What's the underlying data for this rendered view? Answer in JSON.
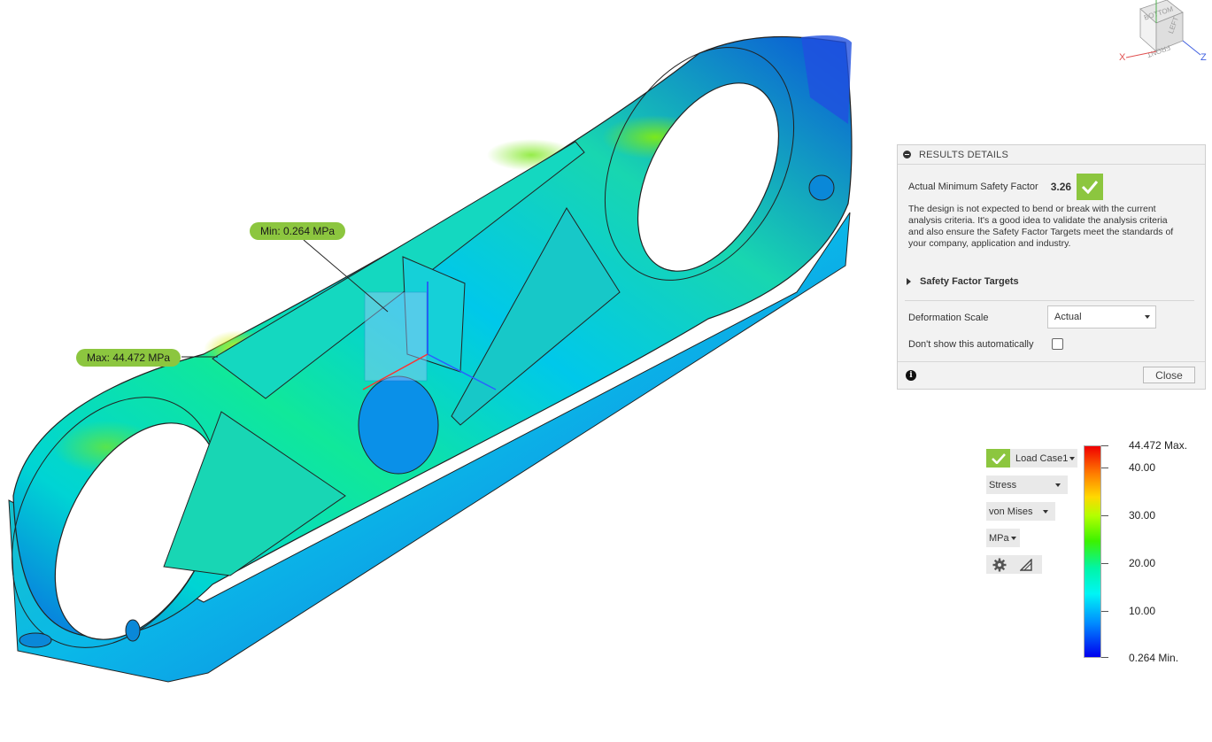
{
  "viewport": {
    "min_callout": "Min: 0.264 MPa",
    "max_callout": "Max: 44.472 MPa"
  },
  "viewcube": {
    "faces": [
      "BOTTOM",
      "LEFT",
      "FRONT"
    ],
    "axes": [
      "X",
      "Z"
    ]
  },
  "results_details": {
    "header": "RESULTS DETAILS",
    "safety_factor_label": "Actual Minimum Safety Factor",
    "safety_factor_value": "3.26",
    "description": "The design is not expected to bend or break with the current analysis criteria. It's a good idea to validate the analysis criteria and also ensure the Safety Factor Targets meet the standards of your company, application and industry.",
    "targets_label": "Safety Factor Targets",
    "deformation_label": "Deformation Scale",
    "deformation_value": "Actual",
    "dont_show_label": "Don't show this automatically",
    "close_label": "Close"
  },
  "result_controls": {
    "load_case": "Load Case1",
    "result_type": "Stress",
    "stress_component": "von Mises",
    "unit": "MPa"
  },
  "legend": {
    "max_label": "44.472 Max.",
    "min_label": "0.264 Min.",
    "ticks": [
      "40.00",
      "30.00",
      "20.00",
      "10.00"
    ]
  },
  "colors": {
    "accent_green": "#8cc63f",
    "stress_low": "#0000ee",
    "stress_mid": "#00f5f5",
    "stress_high": "#f00000"
  }
}
